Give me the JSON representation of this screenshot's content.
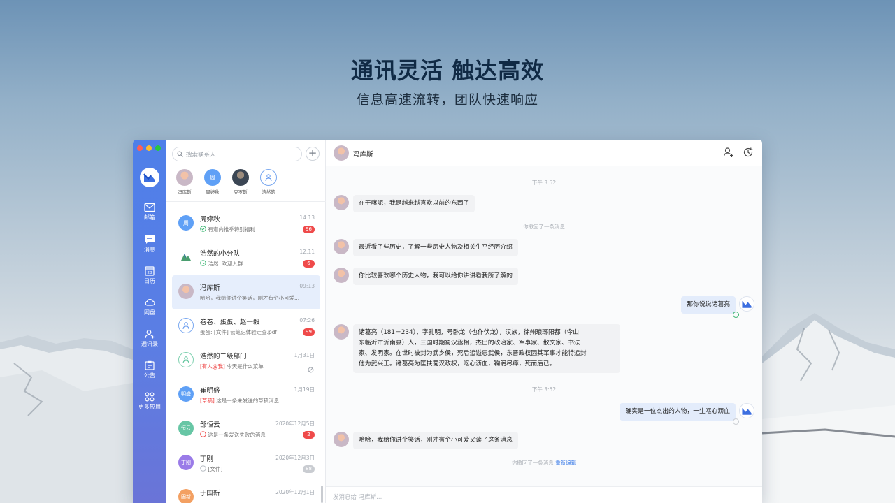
{
  "hero": {
    "title": "通讯灵活 触达高效",
    "subtitle": "信息高速流转，团队快速响应"
  },
  "nav": {
    "items": [
      {
        "label": "邮箱",
        "icon": "mail-icon"
      },
      {
        "label": "消息",
        "icon": "message-icon"
      },
      {
        "label": "日历",
        "icon": "calendar-icon",
        "calendar_day": "28"
      },
      {
        "label": "网盘",
        "icon": "cloud-icon"
      },
      {
        "label": "通讯录",
        "icon": "contacts-icon"
      },
      {
        "label": "公告",
        "icon": "notice-icon"
      },
      {
        "label": "更多应用",
        "icon": "apps-icon"
      }
    ]
  },
  "list": {
    "search_placeholder": "搜索联系人",
    "add_label": "+",
    "recent": [
      {
        "name": "冯库斯",
        "avatar_text": ""
      },
      {
        "name": "周婷秋",
        "avatar_text": "周"
      },
      {
        "name": "克罗斯",
        "avatar_text": ""
      },
      {
        "name": "浩然的",
        "avatar_text": ""
      }
    ],
    "conversations": [
      {
        "name": "周婷秋",
        "avatar_text": "周",
        "time": "14:13",
        "preview": "有道内推季特别福利",
        "badge": "96"
      },
      {
        "name": "浩然的小分队",
        "avatar_text": "",
        "time": "12:11",
        "preview": "浩然: 欢迎入群",
        "badge": "6"
      },
      {
        "name": "冯库斯",
        "avatar_text": "",
        "time": "09:13",
        "preview": "哈哈，我给你讲个笑话，刚才有个小可爱...",
        "badge": ""
      },
      {
        "name": "卷卷、蛋蛋、赵一毅",
        "avatar_text": "",
        "time": "07:26",
        "preview": "蛋蛋: [文件] 云笔记体验走查.pdf",
        "badge": "99"
      },
      {
        "name": "浩然的二级部门",
        "avatar_text": "",
        "time": "1月31日",
        "preview_tag": "[有人@我]",
        "preview": "今天是什么菜单",
        "badge": ""
      },
      {
        "name": "崔明盛",
        "avatar_text": "明盛",
        "time": "1月19日",
        "preview_tag": "[草稿]",
        "preview": "这是一条未发送的草稿消息",
        "badge": ""
      },
      {
        "name": "邹恒云",
        "avatar_text": "恒云",
        "time": "2020年12月5日",
        "preview": "这是一条发送失败的消息",
        "badge": "2"
      },
      {
        "name": "丁刚",
        "avatar_text": "丁刚",
        "time": "2020年12月3日",
        "preview": "[文件]",
        "badge": "88"
      },
      {
        "name": "于国新",
        "avatar_text": "国新",
        "time": "2020年12月1日",
        "preview": "",
        "badge": ""
      }
    ]
  },
  "chat": {
    "contact_name": "冯库斯",
    "timestamps": [
      "下午 3:52",
      "下午 3:52"
    ],
    "recall_notice": "你撤回了一条消息",
    "recall_notice_2": "你撤回了一条消息",
    "reedit_label": "重新编辑",
    "messages": [
      {
        "from": "them",
        "text": "在干嘛呢，我是越来越喜欢以前的东西了"
      },
      {
        "from": "them",
        "text": "最近看了些历史，了解一些历史人物及相关生平经历介绍"
      },
      {
        "from": "them",
        "text": "你比较喜欢哪个历史人物，我可以给你讲讲看我所了解的"
      },
      {
        "from": "me",
        "text": "那你说说诸葛亮"
      },
      {
        "from": "them",
        "lines": [
          "诸葛亮（181－234），字孔明，号卧龙（也作伏龙），汉族，徐州琅琊阳都（今山",
          "东临沂市沂南县）人，三国时期蜀汉丞相，杰出的政治家、军事家、散文家、书法",
          "家、发明家。在世时被封为武乡侯，死后追谥忠武侯，东晋政权因其军事才能特追封",
          "他为武兴王。诸葛亮为匡扶蜀汉政权，呕心沥血，鞠躬尽瘁，死而后已。"
        ]
      },
      {
        "from": "me",
        "text": "确实是一位杰出的人物，一生呕心沥血"
      },
      {
        "from": "them",
        "text": "哈哈，我给你讲个笑话，刚才有个小可爱又读了这条消息"
      }
    ],
    "input_placeholder": "发消息给 冯库斯..."
  }
}
